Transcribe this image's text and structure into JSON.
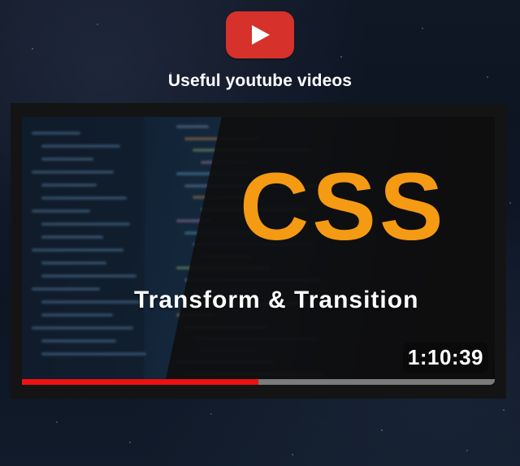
{
  "header": {
    "logo_icon": "youtube-play-icon",
    "title": "Useful youtube videos"
  },
  "video": {
    "thumbnail_title": "CSS",
    "thumbnail_subtitle": "Transform & Transition",
    "duration": "1:10:39",
    "progress_fraction": 0.5
  },
  "colors": {
    "youtube_red": "#d6312b",
    "css_orange": "#f59a13",
    "progress_red": "#ee1111",
    "progress_track": "#7b7b7b"
  }
}
